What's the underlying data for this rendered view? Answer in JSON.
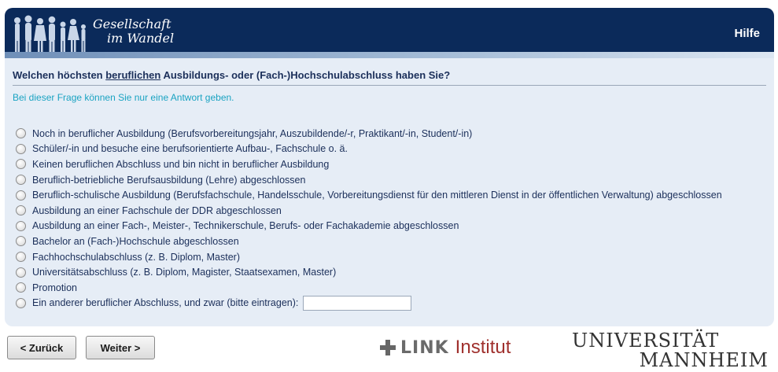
{
  "header": {
    "brand_line1": "Gesellschaft",
    "brand_line2": "im Wandel",
    "help_label": "Hilfe"
  },
  "question": {
    "prefix": "Welchen höchsten ",
    "emphasis": "beruflichen",
    "suffix": " Ausbildungs- oder (Fach-)Hochschulabschluss haben Sie?",
    "instruction": "Bei dieser Frage können Sie nur eine Antwort geben."
  },
  "options": [
    "Noch in beruflicher Ausbildung (Berufsvorbereitungsjahr, Auszubildende/-r, Praktikant/-in, Student/-in)",
    "Schüler/-in und besuche eine berufsorientierte Aufbau-, Fachschule o. ä.",
    "Keinen beruflichen Abschluss und bin nicht in beruflicher Ausbildung",
    "Beruflich-betriebliche Berufsausbildung (Lehre) abgeschlossen",
    "Beruflich-schulische Ausbildung (Berufsfachschule, Handelsschule, Vorbereitungsdienst für den mittleren Dienst in der öffentlichen Verwaltung) abgeschlossen",
    "Ausbildung an einer Fachschule der DDR abgeschlossen",
    "Ausbildung an einer Fach-, Meister-, Technikerschule, Berufs- oder Fachakademie abgeschlossen",
    "Bachelor an (Fach-)Hochschule abgeschlossen",
    "Fachhochschulabschluss (z. B. Diplom, Master)",
    "Universitätsabschluss (z. B. Diplom, Magister, Staatsexamen, Master)",
    "Promotion",
    "Ein anderer beruflicher Abschluss, und zwar (bitte eintragen):"
  ],
  "other_input_value": "",
  "nav": {
    "back_label": "< Zurück",
    "next_label": "Weiter >"
  },
  "logos": {
    "link_word": "LINK",
    "institut_word": "Institut",
    "uni_line1": "UNIVERSITÄT",
    "uni_line2": "MANNHEIM"
  },
  "colors": {
    "header_bg": "#0b2a5a",
    "panel_bg": "#e6edf6",
    "question_text": "#1b2f5a",
    "instruction_text": "#1aa3c2",
    "institut_red": "#a0312e"
  }
}
